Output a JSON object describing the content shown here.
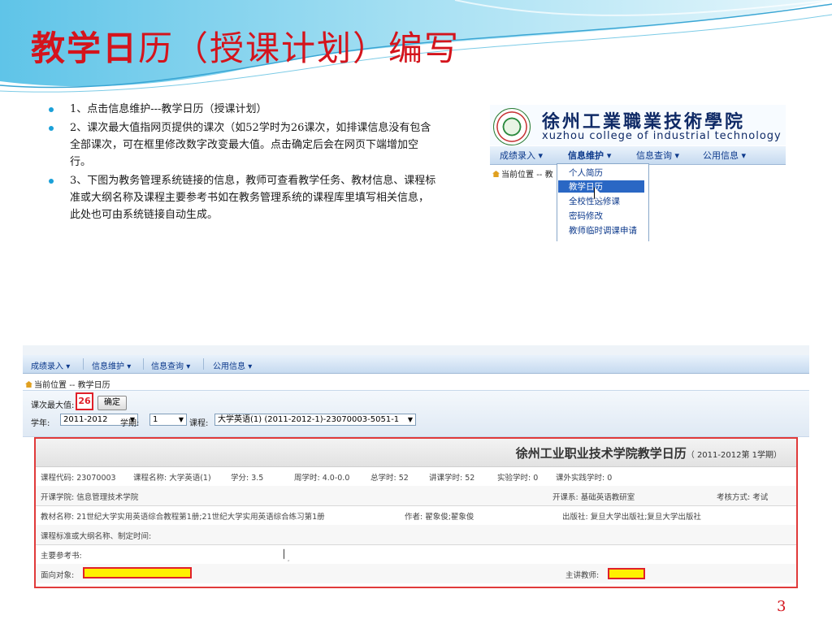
{
  "slide": {
    "title_bold": "教学日",
    "title_rest": "历（授课计划）编写",
    "bullets": [
      "1、点击信息维护---教学日历（授课计划）",
      "2、课次最大值指网页提供的课次（如52学时为26课次，如排课信息没有包含全部课次，可在框里修改数字改变最大值。点击确定后会在网页下端增加空行。",
      "3、下图为教务管理系统链接的信息，教师可查看教学任务、教材信息、课程标准或大纲名称及课程主要参考书如在教务管理系统的课程库里填写相关信息，此处也可由系统链接自动生成。"
    ],
    "page_number": "3"
  },
  "header": {
    "school_cn": "徐州工業職業技術學院",
    "school_en": "xuzhou college of industrial technology"
  },
  "menu": {
    "items": [
      "成绩录入",
      "信息维护",
      "信息查询",
      "公用信息"
    ],
    "arrow": "▾"
  },
  "location": {
    "label": "当前位置",
    "short": "-- 教",
    "full": "-- 教学日历"
  },
  "dropdown": {
    "items": [
      "个人简历",
      "教学日历",
      "全校性选修课",
      "密码修改",
      "教师临时调课申请"
    ],
    "selected_index": 1
  },
  "form": {
    "max_label": "课次最大值:",
    "max_value": "26",
    "confirm_label": "确定",
    "year_label": "学年:",
    "year_value": "2011-2012",
    "term_label": "学期:",
    "term_value": "1",
    "course_label": "课程:",
    "course_value": "大学英语(1) (2011-2012-1)-23070003-5051-1"
  },
  "calendar": {
    "title": "徐州工业职业技术学院教学日历",
    "subtitle": "（ 2011-2012第 1学期）",
    "row1": {
      "course_code": "课程代码:  23070003",
      "course_name": "课程名称:  大学英语(1)",
      "credit": "学分:  3.5",
      "weekly": "周学时:  4.0-0.0",
      "total": "总学时:  52",
      "lecture": "讲课学时:  52",
      "lab": "实验学时:  0",
      "practice": "课外实践学时:  0"
    },
    "row2": {
      "college": "开课学院:  信息管理技术学院",
      "dept": "开课系:  基础英语教研室",
      "exam": "考核方式:  考试"
    },
    "row3": {
      "textbook": "教材名称:  21世纪大学实用英语综合教程第1册;21世纪大学实用英语综合练习第1册",
      "author": "作者:  翟象俊;翟象俊",
      "publisher": "出版社:  复旦大学出版社;复旦大学出版社"
    },
    "row4": "课程标准或大纲名称、制定时间:",
    "row5": "主要参考书:",
    "row6": {
      "target": "面向对象:",
      "teacher": "主讲教师:"
    }
  },
  "colors": {
    "title_red": "#d4141c",
    "bullet_blue": "#1aa0d8",
    "highlight_yellow": "#fff000",
    "outline_red": "#e0202a"
  }
}
